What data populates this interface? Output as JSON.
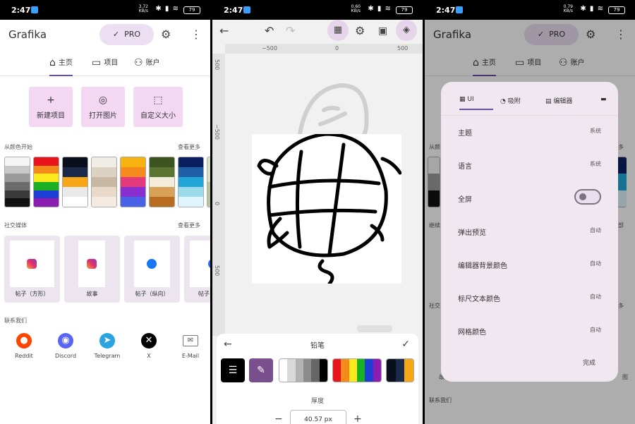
{
  "status": {
    "time": "2:47",
    "net_p1": "3.72\nKB/s",
    "net_p2": "0.60\nKB/s",
    "net_p3": "0.79\nKB/s",
    "battery": "79"
  },
  "app": {
    "title": "Grafika",
    "pro": "PRO"
  },
  "tabs": [
    "主页",
    "项目",
    "账户"
  ],
  "quick_actions": [
    "新建项目",
    "打开图片",
    "自定义大小"
  ],
  "colors_section": {
    "title": "从颜色开始",
    "more": "查看更多"
  },
  "palettes": [
    [
      "#f5f5f5",
      "#c8c8c8",
      "#9b9b9b",
      "#6c6c6c",
      "#3a3a3a",
      "#111111"
    ],
    [
      "#e8131b",
      "#f38b1a",
      "#fbe91e",
      "#1bb021",
      "#1d3fd5",
      "#8d1cb1"
    ],
    [
      "#0a0f1d",
      "#1b2a4a",
      "#f6a616",
      "#e9e9e9",
      "#ffffff"
    ],
    [
      "#f0ede7",
      "#dcd2c3",
      "#c8b7a2",
      "#e8d9c8",
      "#f5eadf"
    ],
    [
      "#f6b20e",
      "#f68a1c",
      "#e33a7c",
      "#8a2ed0",
      "#4a63e6"
    ],
    [
      "#3b5420",
      "#5c7531",
      "#f4ecdb",
      "#d7a257",
      "#b86d20"
    ],
    [
      "#0a1f60",
      "#1f5fa6",
      "#21a5d8",
      "#9cdcea",
      "#dff5fb"
    ],
    [
      "#d9e2c2",
      "#b8c79a"
    ]
  ],
  "social_section": {
    "title": "社交媒体",
    "more": "查看更多"
  },
  "social_cards": [
    "帖子（方形）",
    "故事",
    "帖子（纵向）",
    "帖子"
  ],
  "contact_section": {
    "title": "联系我们"
  },
  "contacts": [
    "Reddit",
    "Discord",
    "Telegram",
    "X",
    "E-Mail"
  ],
  "editor": {
    "ruler_h": [
      "−500",
      "0",
      "500"
    ],
    "ruler_v": [
      "500",
      "−500",
      "0",
      "500"
    ],
    "tool_title": "铅笔",
    "thickness_label": "厚度",
    "thickness_value": "40.57 px",
    "swatch_groups": [
      [
        "#ffffff",
        "#d9d9d9",
        "#b3b3b3",
        "#8c8c8c",
        "#666666",
        "#000000"
      ],
      [
        "#e8131b",
        "#f38b1a",
        "#fbe91e",
        "#1bb021",
        "#1d3fd5",
        "#8d1cb1"
      ],
      [
        "#0a0f1d",
        "#1b2a4a",
        "#f6a616"
      ]
    ]
  },
  "settings": {
    "tabs": [
      "UI",
      "吸附",
      "编辑器"
    ],
    "rows": [
      {
        "label": "主题",
        "value": "系统"
      },
      {
        "label": "语言",
        "value": "系统"
      },
      {
        "label": "全屏",
        "value": ""
      },
      {
        "label": "弹出预览",
        "value": "自动"
      },
      {
        "label": "编辑器背景颜色",
        "value": "自动"
      },
      {
        "label": "标尺文本颜色",
        "value": "自动"
      },
      {
        "label": "网格颜色",
        "value": "自动"
      }
    ],
    "done": "完成",
    "peek_section": "从颜",
    "peek_more": "多",
    "peek_social": "继续",
    "peek_social_more": "部",
    "peek_contact": "社交",
    "peek_contact_more": "多",
    "peek_card": "故",
    "peek_card_right": "图",
    "peek_contact2": "联系我们"
  },
  "accent": "#6750a4"
}
